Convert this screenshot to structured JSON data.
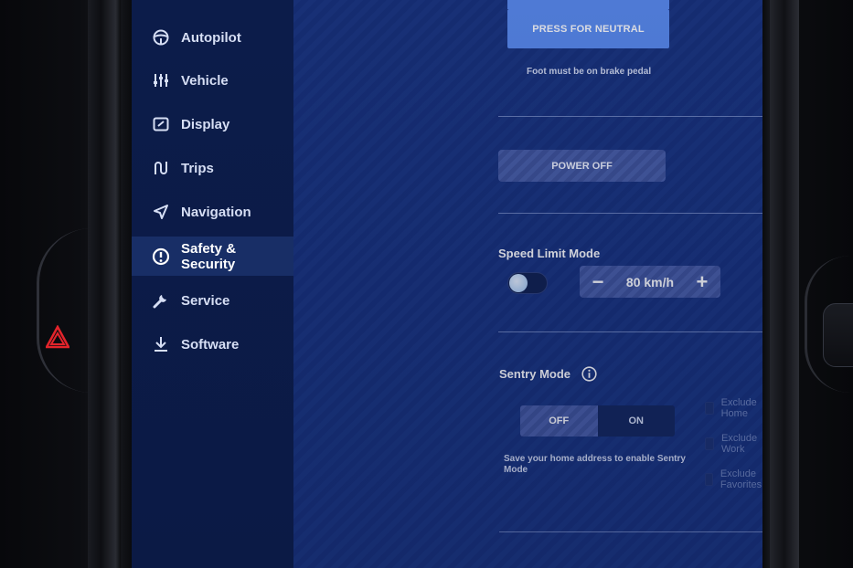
{
  "sidebar": {
    "items": [
      {
        "label": "Autopilot",
        "icon": "steering-wheel-icon"
      },
      {
        "label": "Vehicle",
        "icon": "sliders-icon"
      },
      {
        "label": "Display",
        "icon": "display-icon"
      },
      {
        "label": "Trips",
        "icon": "trips-icon"
      },
      {
        "label": "Navigation",
        "icon": "navigation-arrow-icon"
      },
      {
        "label": "Safety &\nSecurity",
        "icon": "alert-circle-icon",
        "active": true
      },
      {
        "label": "Service",
        "icon": "wrench-icon"
      },
      {
        "label": "Software",
        "icon": "download-icon"
      }
    ]
  },
  "main": {
    "neutral_button": "PRESS FOR NEUTRAL",
    "neutral_note": "Foot must be on brake pedal",
    "power_off_button": "POWER OFF",
    "speed_limit": {
      "title": "Speed Limit Mode",
      "enabled": false,
      "value": "80 km/h",
      "minus": "−",
      "plus": "+"
    },
    "sentry": {
      "title": "Sentry Mode",
      "options": [
        "OFF",
        "ON"
      ],
      "selected": "OFF",
      "note": "Save your home address to enable Sentry Mode",
      "excludes": [
        "Exclude Home",
        "Exclude Work",
        "Exclude Favorites"
      ]
    }
  },
  "colors": {
    "accent": "#5b8cf0",
    "hazard": "#e3242b",
    "screen_bg": "#1a3580",
    "sidebar_bg": "#0c1c4a"
  }
}
